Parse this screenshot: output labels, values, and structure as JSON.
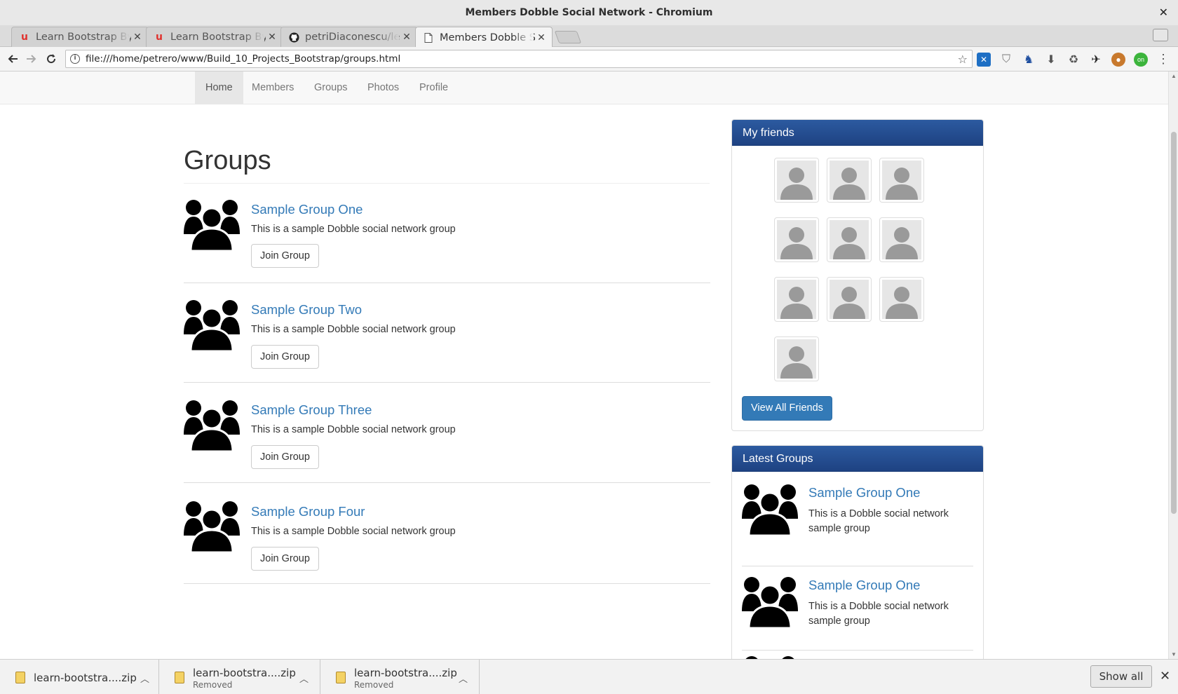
{
  "window": {
    "title": "Members Dobble Social Network - Chromium",
    "close_glyph": "✕"
  },
  "tabs": [
    {
      "label": "Learn Bootstrap By",
      "icon": "udemy-icon",
      "active": false
    },
    {
      "label": "Learn Bootstrap By",
      "icon": "udemy-icon",
      "active": false
    },
    {
      "label": "petriDiaconescu/lea",
      "icon": "github-icon",
      "active": false
    },
    {
      "label": "Members Dobble Sc",
      "icon": "page-icon",
      "active": true
    }
  ],
  "tab_close_glyph": "✕",
  "address_bar": {
    "url": "file:///home/petrero/www/Build_10_Projects_Bootstrap/groups.html"
  },
  "navbar": {
    "items": [
      "Home",
      "Members",
      "Groups",
      "Photos",
      "Profile"
    ],
    "active": "Home"
  },
  "main": {
    "heading": "Groups",
    "groups": [
      {
        "title": "Sample Group One",
        "description": "This is a sample Dobble social network group",
        "button": "Join Group"
      },
      {
        "title": "Sample Group Two",
        "description": "This is a sample Dobble social network group",
        "button": "Join Group"
      },
      {
        "title": "Sample Group Three",
        "description": "This is a sample Dobble social network group",
        "button": "Join Group"
      },
      {
        "title": "Sample Group Four",
        "description": "This is a sample Dobble social network group",
        "button": "Join Group"
      }
    ]
  },
  "sidebar": {
    "friends_panel": {
      "heading": "My friends",
      "friend_count": 10,
      "button": "View All Friends"
    },
    "latest_groups_panel": {
      "heading": "Latest Groups",
      "items": [
        {
          "title": "Sample Group One",
          "description": "This is a Dobble social network sample group"
        },
        {
          "title": "Sample Group One",
          "description": "This is a Dobble social network sample group"
        }
      ]
    }
  },
  "downloads": {
    "items": [
      {
        "name": "learn-bootstra....zip",
        "status": ""
      },
      {
        "name": "learn-bootstra....zip",
        "status": "Removed"
      },
      {
        "name": "learn-bootstra....zip",
        "status": "Removed"
      }
    ],
    "show_all": "Show all",
    "close_glyph": "✕"
  },
  "colors": {
    "link": "#337ab7",
    "panel_heading": "#1e4282",
    "primary_button": "#337ab7"
  }
}
